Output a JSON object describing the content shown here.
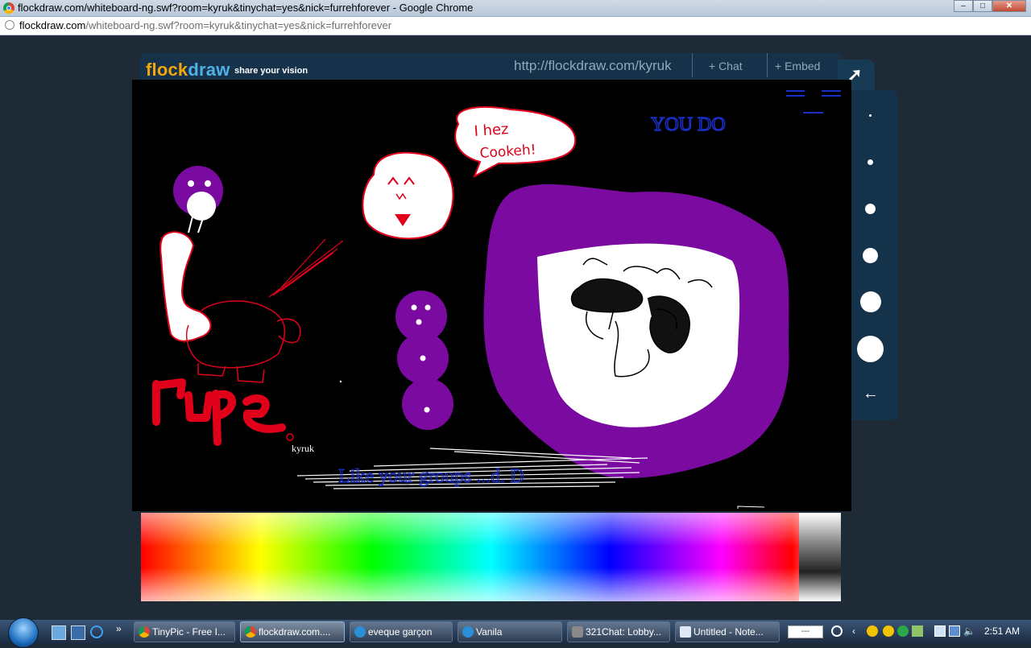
{
  "browser": {
    "window_title": "flockdraw.com/whiteboard-ng.swf?room=kyruk&tinychat=yes&nick=furrehforever - Google Chrome",
    "url_host": "flockdraw.com",
    "url_rest": "/whiteboard-ng.swf?room=kyruk&tinychat=yes&nick=furrehforever",
    "window_buttons": {
      "minimize": "–",
      "maximize": "□",
      "close": "✕"
    }
  },
  "flockdraw": {
    "logo_flock": "flock",
    "logo_draw": "draw",
    "tagline": "share your vision",
    "room_url": "http://flockdraw.com/kyruk",
    "chat_label": "+ Chat",
    "embed_label": "+ Embed",
    "expand_icon": "expand-arrow-icon",
    "brush_sizes": [
      2,
      4,
      7,
      10,
      14,
      18
    ],
    "brush_back": "←"
  },
  "canvas": {
    "texts": {
      "you_do": "YOU DO",
      "speech": "I hez Cookeh!",
      "scribble_rape": "rape",
      "cursor_nick": "kyruk",
      "blue_scrawl": "Like your groups   ...d. D"
    },
    "colors": {
      "background": "#000000",
      "purple": "#7a0aa0",
      "red": "#e0001a",
      "white": "#ffffff",
      "blue": "#1a2fc8"
    }
  },
  "taskbar": {
    "start_icon": "windows-orb-icon",
    "overflow": "»",
    "buttons": [
      {
        "label": "TinyPic - Free I...",
        "icon": "chrome-icon",
        "active": false
      },
      {
        "label": "flockdraw.com....",
        "icon": "chrome-icon",
        "active": true
      },
      {
        "label": "eveque garçon",
        "icon": "chat-icon",
        "active": false
      },
      {
        "label": "Vanila",
        "icon": "chat-icon",
        "active": false
      },
      {
        "label": "321Chat: Lobby...",
        "icon": "321chat-icon",
        "active": false
      },
      {
        "label": "Untitled - Note...",
        "icon": "notepad-icon",
        "active": false
      }
    ],
    "tray_box": "---",
    "clock": "2:51 AM"
  }
}
